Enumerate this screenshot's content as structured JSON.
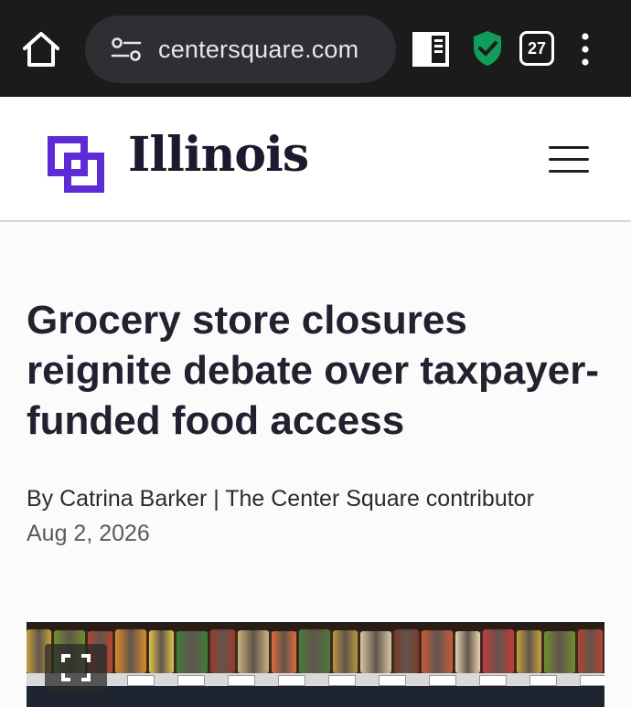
{
  "browser": {
    "url": "centersquare.com",
    "tab_count": "27",
    "icons": {
      "home": "home-icon",
      "site_info": "site-settings-icon",
      "reader": "reader-mode-icon",
      "shield": "shield-check-icon",
      "menu": "more-vert-icon"
    },
    "shield_color": "#0f9d58"
  },
  "site": {
    "logo_text": "Illinois",
    "logo_color": "#5b2bd6",
    "menu_icon": "hamburger-menu-icon"
  },
  "article": {
    "headline": "Grocery store closures reignite debate over taxpayer-funded food access",
    "byline": "By Catrina Barker | The Center Square contributor",
    "date": "Aug 2, 2026",
    "image_alt_icon": "fullscreen-icon"
  }
}
